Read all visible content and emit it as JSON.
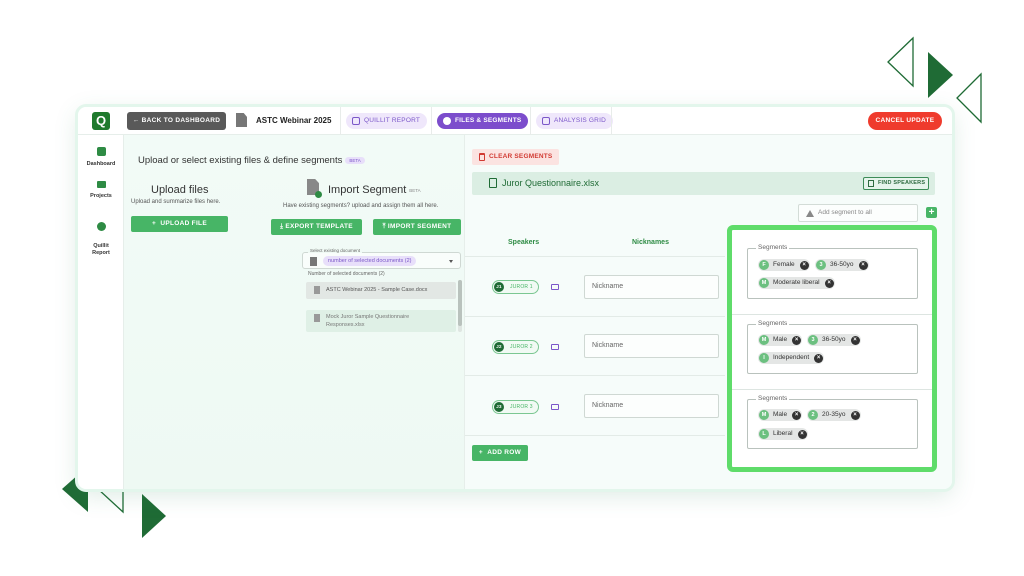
{
  "colors": {
    "brand": "#1f7a2d",
    "accent_green": "#47b566",
    "highlight": "#5fdc6a",
    "purple": "#7c4dcc",
    "danger": "#ef3b2d"
  },
  "logo_letter": "Q",
  "topbar": {
    "back_label": "← BACK TO DASHBOARD",
    "webinar_title": "ASTC Webinar 2025",
    "tabs": [
      {
        "label": "QUILLIT REPORT",
        "icon": "report-icon"
      },
      {
        "label": "FILES & SEGMENTS",
        "icon": "files-icon",
        "active": true
      },
      {
        "label": "ANALYSIS GRID",
        "icon": "grid-icon"
      }
    ],
    "cancel_label": "CANCEL UPDATE"
  },
  "sidebar": {
    "items": [
      {
        "label": "Dashboard",
        "icon": "dashboard-icon"
      },
      {
        "label": "Projects",
        "icon": "folder-icon"
      },
      {
        "label": "Quillit\nReport",
        "icon": "quillit-icon"
      }
    ]
  },
  "left": {
    "title": "Upload or select existing files & define segments",
    "title_badge": "BETA",
    "upload_title": "Upload files",
    "upload_sub": "Upload and summarize files here.",
    "upload_button": "UPLOAD FILE",
    "import_title": "Import Segment",
    "import_badge": "BETA",
    "import_sub": "Have existing segments? upload and assign them all here.",
    "export_button": "EXPORT TEMPLATE",
    "import_button": "IMPORT SEGMENT",
    "select_label": "Select existing document",
    "select_value": "number of selected documents (2)",
    "num_label": "Number of selected documents (2)",
    "documents": [
      "ASTC Webinar 2025 - Sample Case.docx",
      "Mock Juror Sample Questionnaire",
      "Responses.xlsx"
    ]
  },
  "right": {
    "clear_button": "CLEAR SEGMENTS",
    "file_name": "Juror Questionnaire.xlsx",
    "find_button": "FIND SPEAKERS",
    "add_segment_placeholder": "Add segment to all",
    "col_speakers": "Speakers",
    "col_nicknames": "Nicknames",
    "add_row_button": "ADD ROW",
    "rows": [
      {
        "id": "J1",
        "label": "JUROR 1",
        "nickname_placeholder": "Nickname",
        "segments_label": "Segments",
        "chips": [
          {
            "letter": "F",
            "text": "Female"
          },
          {
            "letter": "3",
            "text": "36-50yo"
          },
          {
            "letter": "M",
            "text": "Moderate liberal"
          }
        ]
      },
      {
        "id": "J2",
        "label": "JUROR 2",
        "nickname_placeholder": "Nickname",
        "segments_label": "Segments",
        "chips": [
          {
            "letter": "M",
            "text": "Male"
          },
          {
            "letter": "3",
            "text": "36-50yo"
          },
          {
            "letter": "I",
            "text": "Independent"
          }
        ]
      },
      {
        "id": "J3",
        "label": "JUROR 3",
        "nickname_placeholder": "Nickname",
        "segments_label": "Segments",
        "chips": [
          {
            "letter": "M",
            "text": "Male"
          },
          {
            "letter": "2",
            "text": "20-35yo"
          },
          {
            "letter": "L",
            "text": "Liberal"
          }
        ]
      }
    ]
  }
}
